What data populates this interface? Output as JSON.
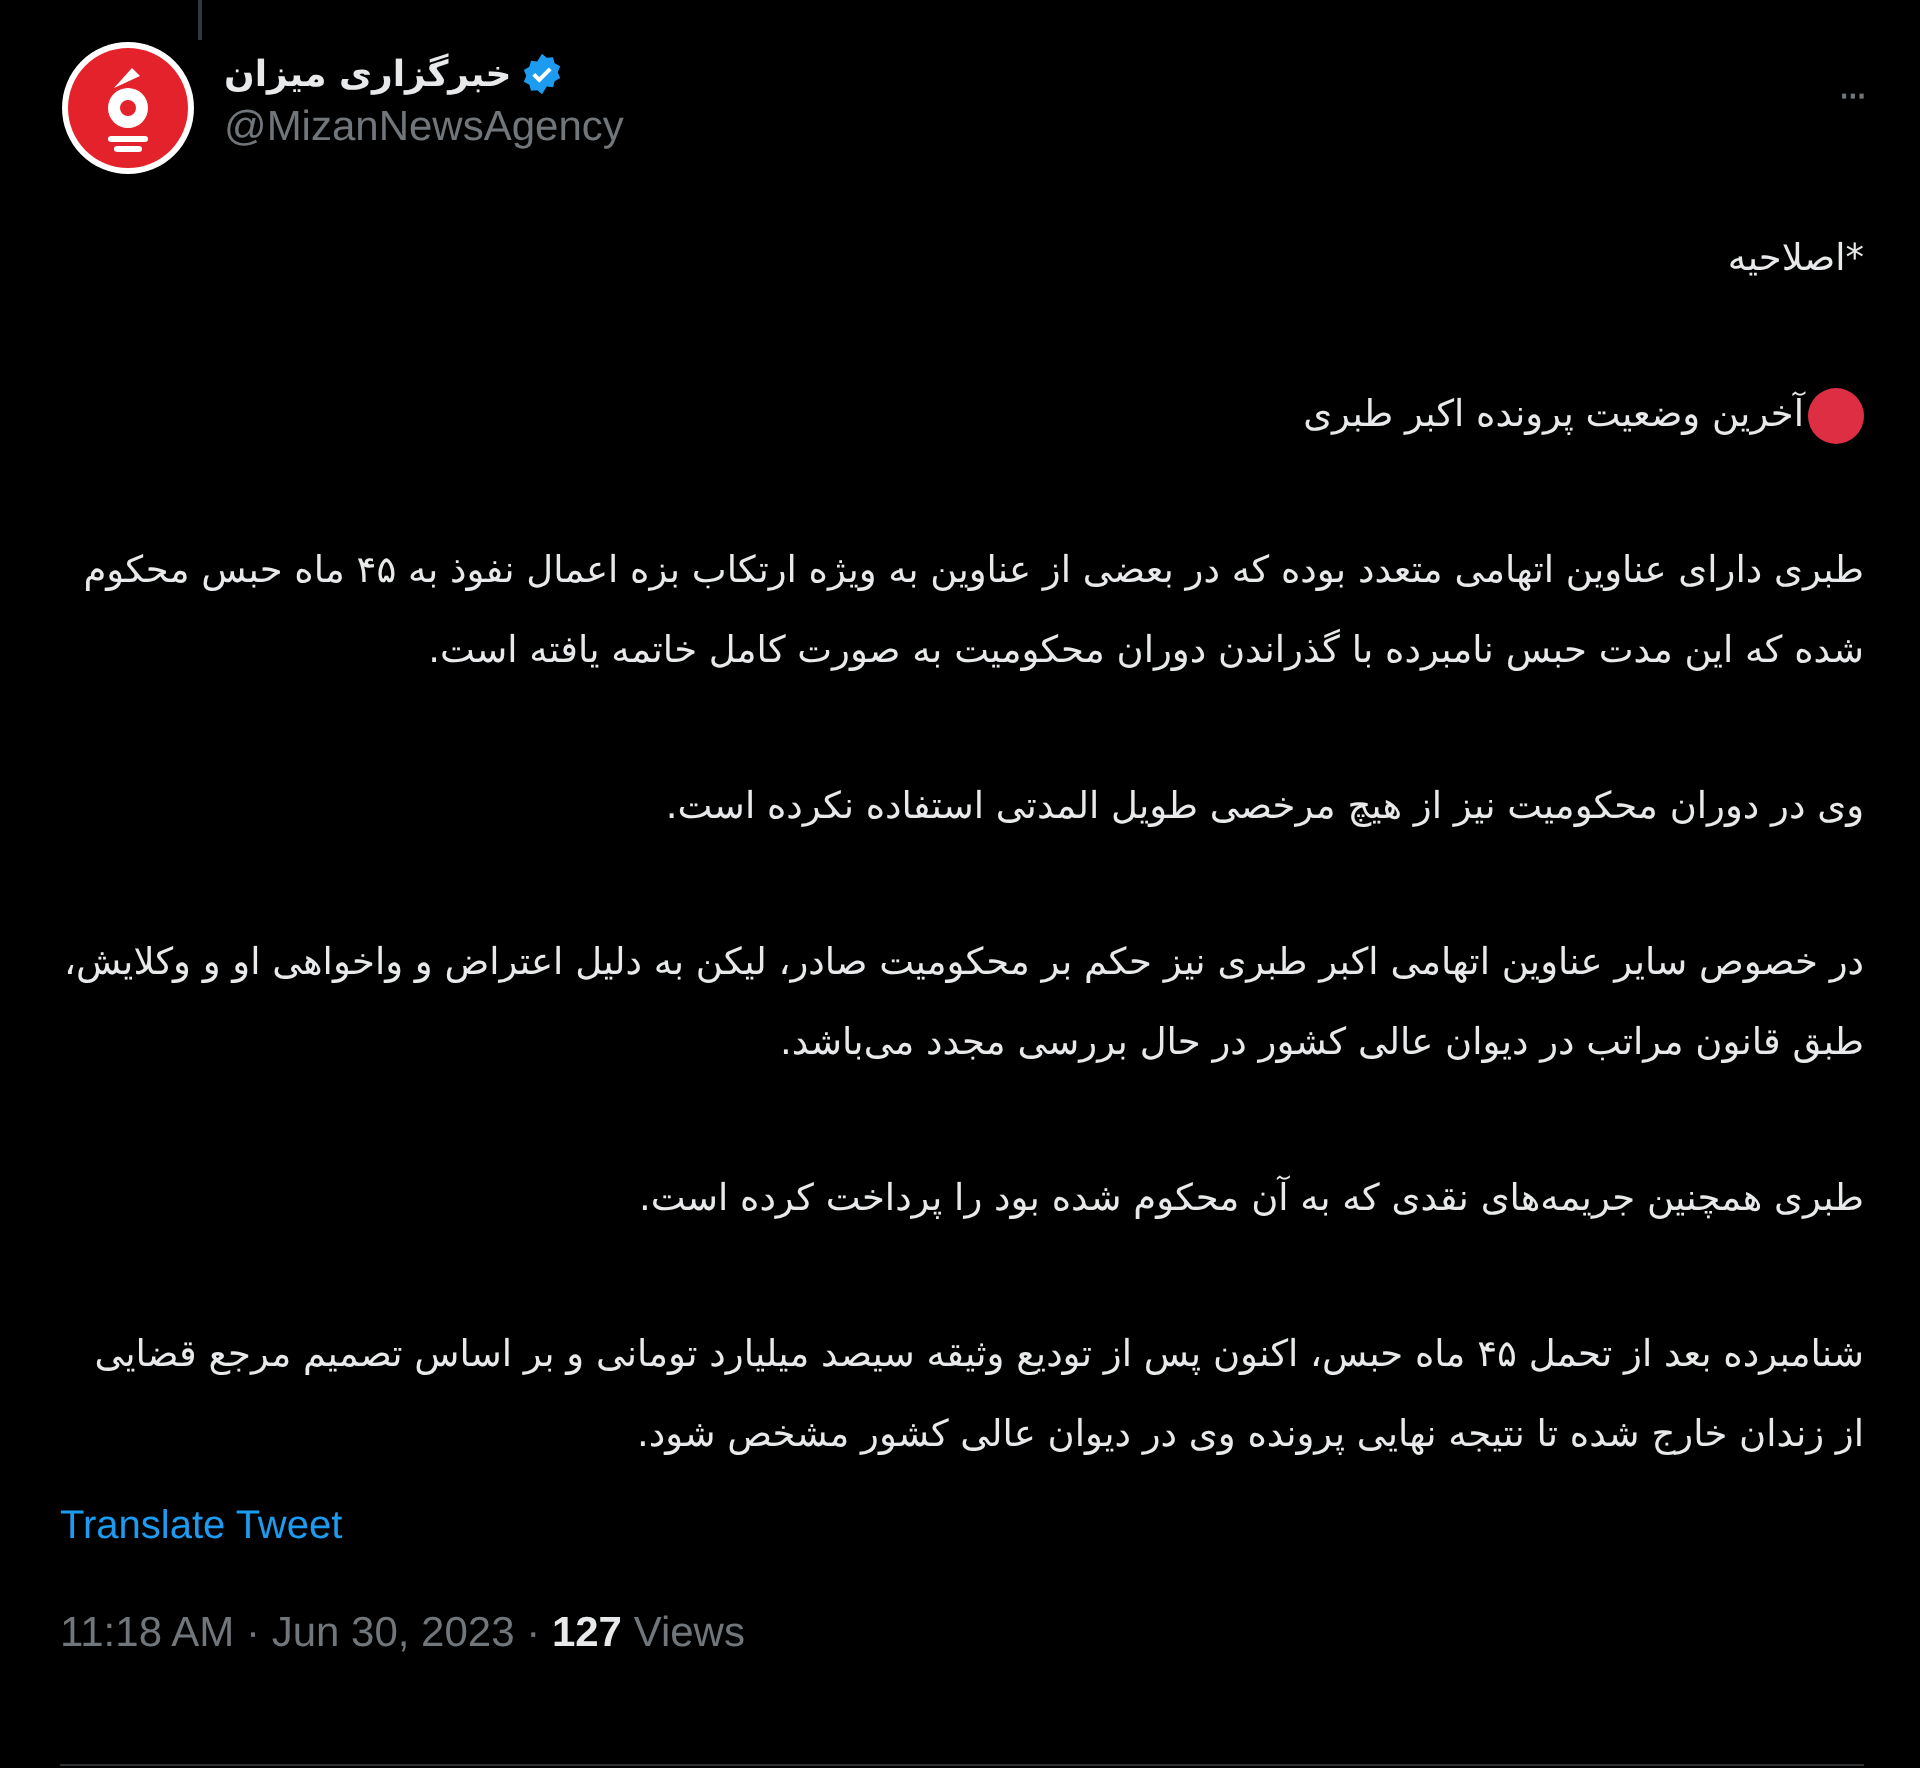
{
  "author": {
    "name": "خبرگزاری میزان",
    "verified": true,
    "handle": "@MizanNewsAgency"
  },
  "more_label": "···",
  "heading": "*اصلاحیه",
  "headline": {
    "text": "آخرین وضعیت پرونده اکبر طبری"
  },
  "paragraphs": [
    "طبری دارای عناوین اتهامی متعدد بوده که در بعضی  از عناوین به ویژه ارتکاب بزه اعمال نفوذ به ۴۵ ماه حبس محکوم شده که این  مدت حبس نامبرده با گذراندن دوران محکومیت به صورت کامل خاتمه یافته است.",
    "وی در دوران محکومیت نیز از هیچ مرخصی طویل المدتی استفاده نکرده است.",
    "در خصوص سایر عناوین اتهامی اکبر طبری نیز حکم بر محکومیت صادر، لیکن به  دلیل اعتراض و واخواهی او و وکلایش، طبق قانون مراتب در دیوان عالی کشور  در حال بررسی مجدد می‌باشد.",
    "طبری همچنین جریمه‌های نقدی که به آن محکوم شده بود را پرداخت کرده است.",
    "شنامبرده بعد از تحمل ۴۵ ماه حبس، اکنون پس از تودیع  وثیقه سیصد میلیارد تومانی و بر اساس تصمیم مرجع قضایی از زندان خارج شده تا نتیجه نهایی پرونده وی در دیوان عالی کشور مشخص شود."
  ],
  "translate_link": "Translate Tweet",
  "meta": "11:18 AM · Jun 30, 2023 · **127** Views"
}
